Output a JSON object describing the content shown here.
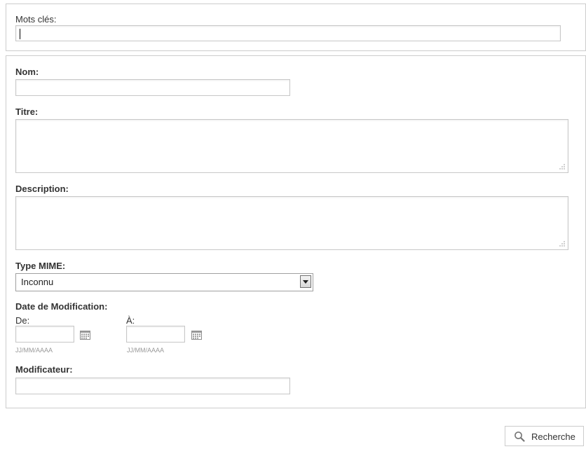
{
  "keywords": {
    "label": "Mots clés:",
    "value": ""
  },
  "form": {
    "nom": {
      "label": "Nom:",
      "value": ""
    },
    "titre": {
      "label": "Titre:",
      "value": ""
    },
    "description": {
      "label": "Description:",
      "value": ""
    },
    "mime": {
      "label": "Type MIME:",
      "selected": "Inconnu"
    },
    "date": {
      "label": "Date de Modification:",
      "from_label": "De:",
      "to_label": "À:",
      "from_value": "",
      "to_value": "",
      "format_hint_from": "JJ/MM/AAAA",
      "format_hint_to": "JJ/MM/AAAA"
    },
    "modificateur": {
      "label": "Modificateur:",
      "value": ""
    }
  },
  "actions": {
    "search_label": "Recherche"
  },
  "icons": {
    "calendar": "calendar-icon",
    "search": "magnifier-icon",
    "dropdown": "chevron-down-icon",
    "resize": "resize-grip-icon"
  }
}
